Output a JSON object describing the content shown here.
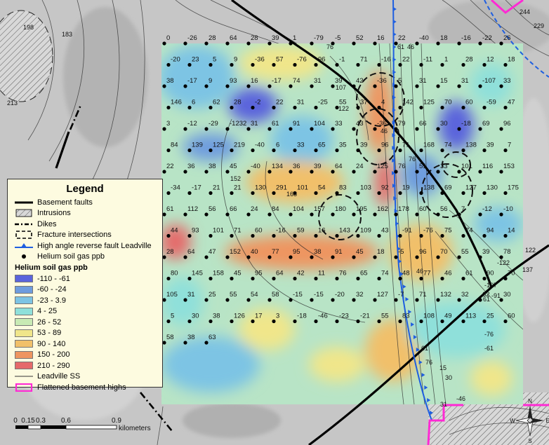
{
  "legend": {
    "title": "Legend",
    "items": [
      {
        "label": "Basement faults",
        "symbol": "thick-line-icon"
      },
      {
        "label": "Intrusions",
        "symbol": "hatch-box-icon"
      },
      {
        "label": "Dikes",
        "symbol": "dash-dot-line-icon"
      },
      {
        "label": "Fracture intersections",
        "symbol": "dashed-box-icon"
      },
      {
        "label": "High angle reverse fault Leadville",
        "symbol": "triangle-line-icon"
      },
      {
        "label": "Helium soil gas ppb",
        "symbol": "dot-icon"
      }
    ],
    "ramp_title": "Helium soil gas ppb",
    "ramp": [
      {
        "label": "-110 - -61",
        "color": "#5a64dc"
      },
      {
        "label": "-60 - -24",
        "color": "#6e9cde"
      },
      {
        "label": "-23 - 3.9",
        "color": "#7dc4e4"
      },
      {
        "label": "4 - 25",
        "color": "#8fe0da"
      },
      {
        "label": "26 - 52",
        "color": "#c8eab4"
      },
      {
        "label": "53 - 89",
        "color": "#f0e68a"
      },
      {
        "label": "90 - 140",
        "color": "#f1c06a"
      },
      {
        "label": "150 - 200",
        "color": "#ee9560"
      },
      {
        "label": "210 - 290",
        "color": "#e56a6a"
      }
    ],
    "extra_items": [
      {
        "label": "Leadville SS",
        "symbol": "thin-line-icon"
      },
      {
        "label": "Flattened basement highs",
        "symbol": "magenta-box-icon"
      }
    ]
  },
  "scalebar": {
    "ticks": [
      "0",
      "0.15",
      "0.3",
      "0.6",
      "0.9"
    ],
    "unit": "kilometers"
  },
  "north_arrow": {
    "N": "N",
    "S": "S",
    "E": "E",
    "W": "W"
  },
  "contour_labels": [
    "198",
    "183",
    "213",
    "76",
    "107",
    "122",
    "46",
    "152",
    "168",
    "61",
    "46",
    "76",
    "46",
    "61",
    "76",
    "15",
    "30",
    "61",
    "122",
    "137",
    "-122",
    "-107",
    "-91",
    "-76",
    "-61",
    "-46",
    "31",
    "244",
    "229"
  ],
  "samples": [
    "0",
    "-26",
    "28",
    "64",
    "28",
    "39",
    "1",
    "-79",
    "-5",
    "52",
    "16",
    "22",
    "-40",
    "18",
    "-16",
    "-22",
    "26",
    "-20",
    "23",
    "5",
    "9",
    "-36",
    "57",
    "-76",
    "96",
    "-1",
    "71",
    "-16",
    "22",
    "-11",
    "1",
    "28",
    "12",
    "18",
    "38",
    "-17",
    "9",
    "93",
    "16",
    "-17",
    "74",
    "31",
    "39",
    "42",
    "-36",
    "5",
    "31",
    "15",
    "31",
    "-107",
    "33",
    "146",
    "6",
    "62",
    "28",
    "-2",
    "22",
    "31",
    "-25",
    "55",
    "37",
    "4",
    "142",
    "125",
    "70",
    "60",
    "-59",
    "47",
    "3",
    "-12",
    "-29",
    "-1232",
    "31",
    "61",
    "91",
    "104",
    "33",
    "43",
    "-36",
    "79",
    "66",
    "30",
    "-18",
    "69",
    "96",
    "84",
    "139",
    "125",
    "219",
    "-40",
    "6",
    "33",
    "65",
    "35",
    "39",
    "96",
    "71",
    "168",
    "74",
    "138",
    "39",
    "7",
    "22",
    "36",
    "38",
    "45",
    "-40",
    "134",
    "36",
    "39",
    "64",
    "24",
    "125",
    "76",
    "51",
    "33",
    "101",
    "116",
    "153",
    "-34",
    "-17",
    "21",
    "21",
    "130",
    "291",
    "101",
    "54",
    "83",
    "103",
    "92",
    "19",
    "138",
    "69",
    "127",
    "130",
    "175",
    "61",
    "112",
    "56",
    "66",
    "24",
    "84",
    "104",
    "157",
    "180",
    "195",
    "162",
    "178",
    "60",
    "56",
    "7",
    "-12",
    "-10",
    "44",
    "93",
    "101",
    "71",
    "60",
    "-16",
    "59",
    "16",
    "143",
    "109",
    "43",
    "-91",
    "-76",
    "75",
    "74",
    "94",
    "14",
    "28",
    "64",
    "47",
    "152",
    "40",
    "77",
    "95",
    "38",
    "91",
    "45",
    "18",
    "-5",
    "96",
    "70",
    "55",
    "39",
    "78",
    "80",
    "145",
    "158",
    "45",
    "95",
    "64",
    "42",
    "11",
    "76",
    "65",
    "74",
    "48",
    "77",
    "46",
    "61",
    "90",
    "70",
    "105",
    "31",
    "25",
    "55",
    "54",
    "58",
    "-15",
    "-15",
    "-20",
    "32",
    "127",
    "-7",
    "71",
    "132",
    "32",
    "62",
    "30",
    "5",
    "30",
    "38",
    "126",
    "17",
    "3",
    "-18",
    "-46",
    "-23",
    "-21",
    "55",
    "83",
    "108",
    "49",
    "113",
    "25",
    "60",
    "58",
    "38",
    "63"
  ]
}
